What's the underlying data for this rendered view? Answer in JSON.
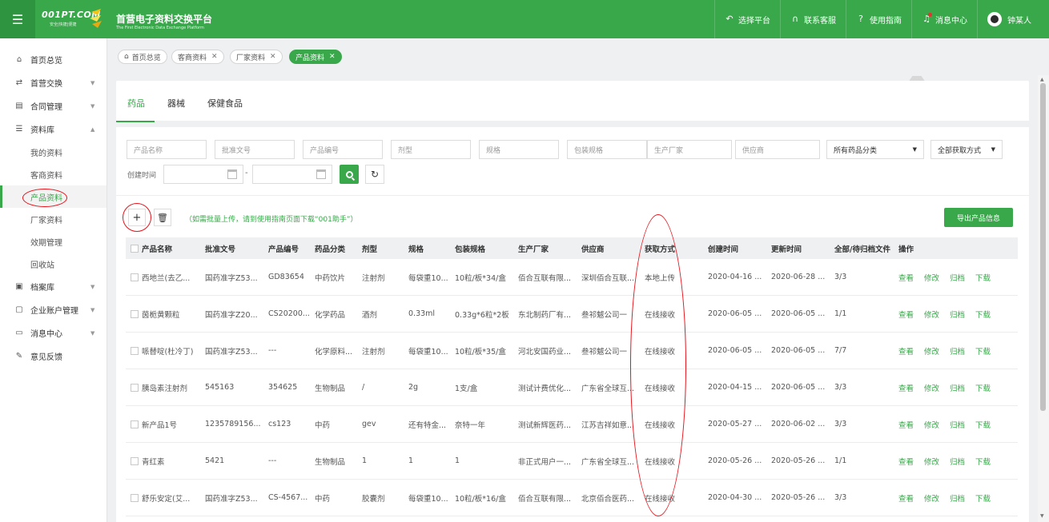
{
  "header": {
    "menu_icon": "hamburger-icon",
    "logo_text": "001PT.COM",
    "logo_sub": "安全|快捷|便捷",
    "title": "首营电子资料交换平台",
    "subtitle": "The First Electronic Data Exchange Platform",
    "nav": [
      {
        "label": "选择平台",
        "icon": "return-icon"
      },
      {
        "label": "联系客服",
        "icon": "headset-icon"
      },
      {
        "label": "使用指南",
        "icon": "help-icon"
      },
      {
        "label": "消息中心",
        "icon": "bell-icon"
      },
      {
        "label": "钟某人",
        "icon": "avatar-icon"
      }
    ],
    "colors": {
      "brand": "#38a84a",
      "alert": "#e83030"
    }
  },
  "sidebar": {
    "items": [
      {
        "label": "首页总览",
        "icon": "home-icon"
      },
      {
        "label": "首营交换",
        "icon": "exchange-icon"
      },
      {
        "label": "合同管理",
        "icon": "contract-icon"
      },
      {
        "label": "资料库",
        "icon": "library-icon"
      }
    ],
    "library_sub": [
      "我的资料",
      "客商资料",
      "产品资料",
      "厂家资料",
      "效期管理",
      "回收站"
    ],
    "bottom_items": [
      {
        "label": "档案库",
        "icon": "archive-icon"
      },
      {
        "label": "企业账户管理",
        "icon": "account-icon"
      },
      {
        "label": "消息中心",
        "icon": "message-icon"
      },
      {
        "label": "意见反馈",
        "icon": "feedback-icon"
      }
    ]
  },
  "breadcrumb_tabs": [
    {
      "label": "首页总览"
    },
    {
      "label": "客商资料"
    },
    {
      "label": "厂家资料"
    },
    {
      "label": "产品资料"
    }
  ],
  "categories": [
    "药品",
    "器械",
    "保健食品"
  ],
  "filters": {
    "placeholders": [
      "产品名称",
      "批准文号",
      "产品编号",
      "剂型",
      "规格",
      "包装规格",
      "生产厂家",
      "供应商"
    ],
    "category_select": "所有药品分类",
    "method_select": "全部获取方式",
    "date_label": "创建时间",
    "date_sep": "-"
  },
  "toolbar": {
    "hint": "（如需批量上传，请到使用指南页面下载“001助手”）",
    "export_label": "导出产品信息"
  },
  "table": {
    "headers": [
      "产品名称",
      "批准文号",
      "产品编号",
      "药品分类",
      "剂型",
      "规格",
      "包装规格",
      "生产厂家",
      "供应商",
      "获取方式",
      "创建时间",
      "更新时间",
      "全部/待归档文件",
      "操作"
    ],
    "actions": [
      "查看",
      "修改",
      "归档",
      "下载"
    ],
    "rows": [
      [
        "西地兰(去乙...",
        "国药准字Z53...",
        "GD83654",
        "中药饮片",
        "注射剂",
        "每袋重10...",
        "10粒/板*34/盒",
        "佰合互联有限...",
        "深圳佰合互联...",
        "本地上传",
        "2020-04-16 ...",
        "2020-06-28 ...",
        "3/3"
      ],
      [
        "茵栀黄颗粒",
        "国药准字Z20...",
        "CS20200...",
        "化学药品",
        "酒剂",
        "0.33ml",
        "0.33g*6粒*2板",
        "东北制药厂有...",
        "叁祁魃公司一",
        "在线接收",
        "2020-06-05 ...",
        "2020-06-05 ...",
        "1/1"
      ],
      [
        "哌替啶(杜冷丁)",
        "国药准字Z53...",
        "---",
        "化学原料...",
        "注射剂",
        "每袋重10...",
        "10粒/板*35/盒",
        "河北安国药业...",
        "叁祁魃公司一",
        "在线接收",
        "2020-06-05 ...",
        "2020-06-05 ...",
        "7/7"
      ],
      [
        "胰岛素注射剂",
        "545163",
        "354625",
        "生物制品",
        "/",
        "2g",
        "1支/盒",
        "测试计费优化...",
        "广东省全球互...",
        "在线接收",
        "2020-04-15 ...",
        "2020-06-05 ...",
        "3/3"
      ],
      [
        "新产品1号",
        "1235789156...",
        "cs123",
        "中药",
        "gev",
        "还有特金...",
        "奈特一年",
        "测试新辉医药...",
        "江苏吉祥如意...",
        "在线接收",
        "2020-05-27 ...",
        "2020-06-02 ...",
        "3/3"
      ],
      [
        "青红素",
        "5421",
        "---",
        "生物制品",
        "1",
        "1",
        "1",
        "非正式用户一...",
        "广东省全球互...",
        "在线接收",
        "2020-05-26 ...",
        "2020-05-26 ...",
        "1/1"
      ],
      [
        "舒乐安定(艾...",
        "国药准字Z53...",
        "CS-4567...",
        "中药",
        "胶囊剂",
        "每袋重10...",
        "10粒/板*16/盒",
        "佰合互联有限...",
        "北京佰合医药...",
        "在线接收",
        "2020-04-30 ...",
        "2020-05-26 ...",
        "3/3"
      ]
    ]
  }
}
